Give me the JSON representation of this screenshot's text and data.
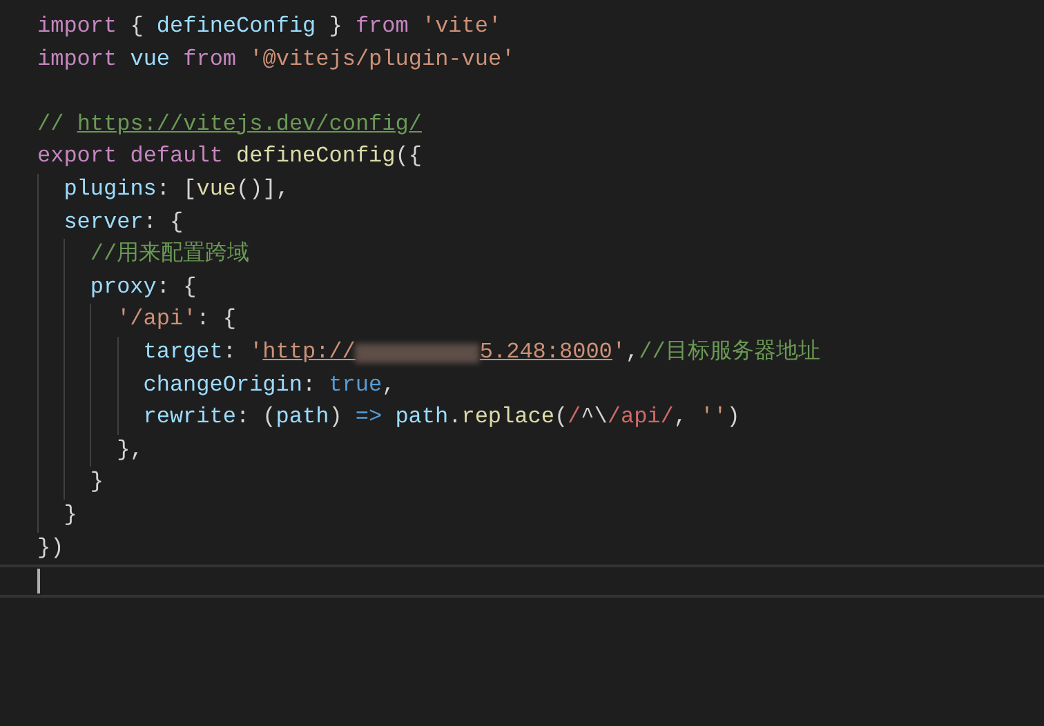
{
  "editor": {
    "lines": [
      {
        "kind": "code",
        "tokens": [
          {
            "kind": "keyword",
            "text": "import "
          },
          {
            "kind": "plain",
            "text": "{ "
          },
          {
            "kind": "variable",
            "text": "defineConfig"
          },
          {
            "kind": "plain",
            "text": " } "
          },
          {
            "kind": "keyword",
            "text": "from "
          },
          {
            "kind": "string",
            "text": "'vite'"
          }
        ]
      },
      {
        "kind": "code",
        "tokens": [
          {
            "kind": "keyword",
            "text": "import "
          },
          {
            "kind": "variable",
            "text": "vue "
          },
          {
            "kind": "keyword",
            "text": "from "
          },
          {
            "kind": "string",
            "text": "'@vitejs/plugin-vue'"
          }
        ]
      },
      {
        "kind": "code"
      },
      {
        "kind": "code",
        "tokens": [
          {
            "kind": "comment",
            "text": "// "
          },
          {
            "kind": "comment-link",
            "text": "https://vitejs.dev/config/"
          }
        ]
      },
      {
        "kind": "code",
        "tokens": [
          {
            "kind": "keyword",
            "text": "export "
          },
          {
            "kind": "keyword",
            "text": "default "
          },
          {
            "kind": "function",
            "text": "defineConfig"
          },
          {
            "kind": "plain",
            "text": "({"
          }
        ],
        "children": [
          {
            "tokens": [
              {
                "kind": "variable",
                "text": "plugins"
              },
              {
                "kind": "plain",
                "text": ": ["
              },
              {
                "kind": "function",
                "text": "vue"
              },
              {
                "kind": "plain",
                "text": "()],"
              }
            ]
          },
          {
            "tokens": [
              {
                "kind": "variable",
                "text": "server"
              },
              {
                "kind": "plain",
                "text": ": {"
              }
            ],
            "children": [
              {
                "tokens": [
                  {
                    "kind": "comment",
                    "text": "//用来配置跨域"
                  }
                ]
              },
              {
                "tokens": [
                  {
                    "kind": "variable",
                    "text": "proxy"
                  },
                  {
                    "kind": "plain",
                    "text": ": {"
                  }
                ],
                "children": [
                  {
                    "tokens": [
                      {
                        "kind": "string",
                        "text": "'/api'"
                      },
                      {
                        "kind": "plain",
                        "text": ": {"
                      }
                    ],
                    "children": [
                      {
                        "tokens": [
                          {
                            "kind": "variable",
                            "text": "target"
                          },
                          {
                            "kind": "plain",
                            "text": ": "
                          },
                          {
                            "kind": "string",
                            "text": "'"
                          },
                          {
                            "kind": "string-link",
                            "text": "http://"
                          },
                          {
                            "kind": "redacted"
                          },
                          {
                            "kind": "string-link",
                            "text": "5.248:8000"
                          },
                          {
                            "kind": "string",
                            "text": "'"
                          },
                          {
                            "kind": "plain",
                            "text": ","
                          },
                          {
                            "kind": "comment",
                            "text": "//目标服务器地址"
                          }
                        ]
                      },
                      {
                        "tokens": [
                          {
                            "kind": "variable",
                            "text": "changeOrigin"
                          },
                          {
                            "kind": "plain",
                            "text": ": "
                          },
                          {
                            "kind": "constant",
                            "text": "true"
                          },
                          {
                            "kind": "plain",
                            "text": ","
                          }
                        ]
                      },
                      {
                        "tokens": [
                          {
                            "kind": "variable",
                            "text": "rewrite"
                          },
                          {
                            "kind": "plain",
                            "text": ": ("
                          },
                          {
                            "kind": "variable",
                            "text": "path"
                          },
                          {
                            "kind": "plain",
                            "text": ") "
                          },
                          {
                            "kind": "constant",
                            "text": "=> "
                          },
                          {
                            "kind": "variable",
                            "text": "path"
                          },
                          {
                            "kind": "plain",
                            "text": "."
                          },
                          {
                            "kind": "function",
                            "text": "replace"
                          },
                          {
                            "kind": "plain",
                            "text": "("
                          },
                          {
                            "kind": "regex",
                            "text": "/"
                          },
                          {
                            "kind": "plain",
                            "text": "^\\"
                          },
                          {
                            "kind": "regex",
                            "text": "/api/"
                          },
                          {
                            "kind": "plain",
                            "text": ", "
                          },
                          {
                            "kind": "string",
                            "text": "''"
                          },
                          {
                            "kind": "plain",
                            "text": ")"
                          }
                        ]
                      }
                    ]
                  },
                  {
                    "tokens": [
                      {
                        "kind": "plain",
                        "text": "},"
                      }
                    ]
                  }
                ]
              },
              {
                "tokens": [
                  {
                    "kind": "plain",
                    "text": "}"
                  }
                ]
              }
            ]
          },
          {
            "tokens": [
              {
                "kind": "plain",
                "text": "}"
              }
            ]
          }
        ]
      },
      {
        "kind": "code",
        "tokens": [
          {
            "kind": "plain",
            "text": "})"
          }
        ]
      },
      {
        "kind": "cursor"
      }
    ]
  }
}
